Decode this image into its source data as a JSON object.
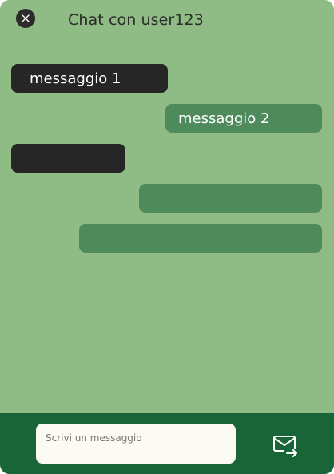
{
  "header": {
    "title": "Chat con user123",
    "close_icon": "close-icon"
  },
  "messages": [
    {
      "direction": "incoming",
      "text": "messaggio 1"
    },
    {
      "direction": "outgoing",
      "text": "messaggio 2"
    },
    {
      "direction": "incoming",
      "text": ""
    },
    {
      "direction": "outgoing",
      "text": ""
    },
    {
      "direction": "outgoing",
      "text": ""
    }
  ],
  "composer": {
    "placeholder": "Scrivi un messaggio",
    "value": "",
    "send_icon": "send-mail-icon"
  },
  "colors": {
    "chat_background": "#8fbb85",
    "incoming_bubble": "#262626",
    "outgoing_bubble": "#4e8a5c",
    "composer_bar": "#1a6538",
    "input_background": "#fdfaf4"
  }
}
